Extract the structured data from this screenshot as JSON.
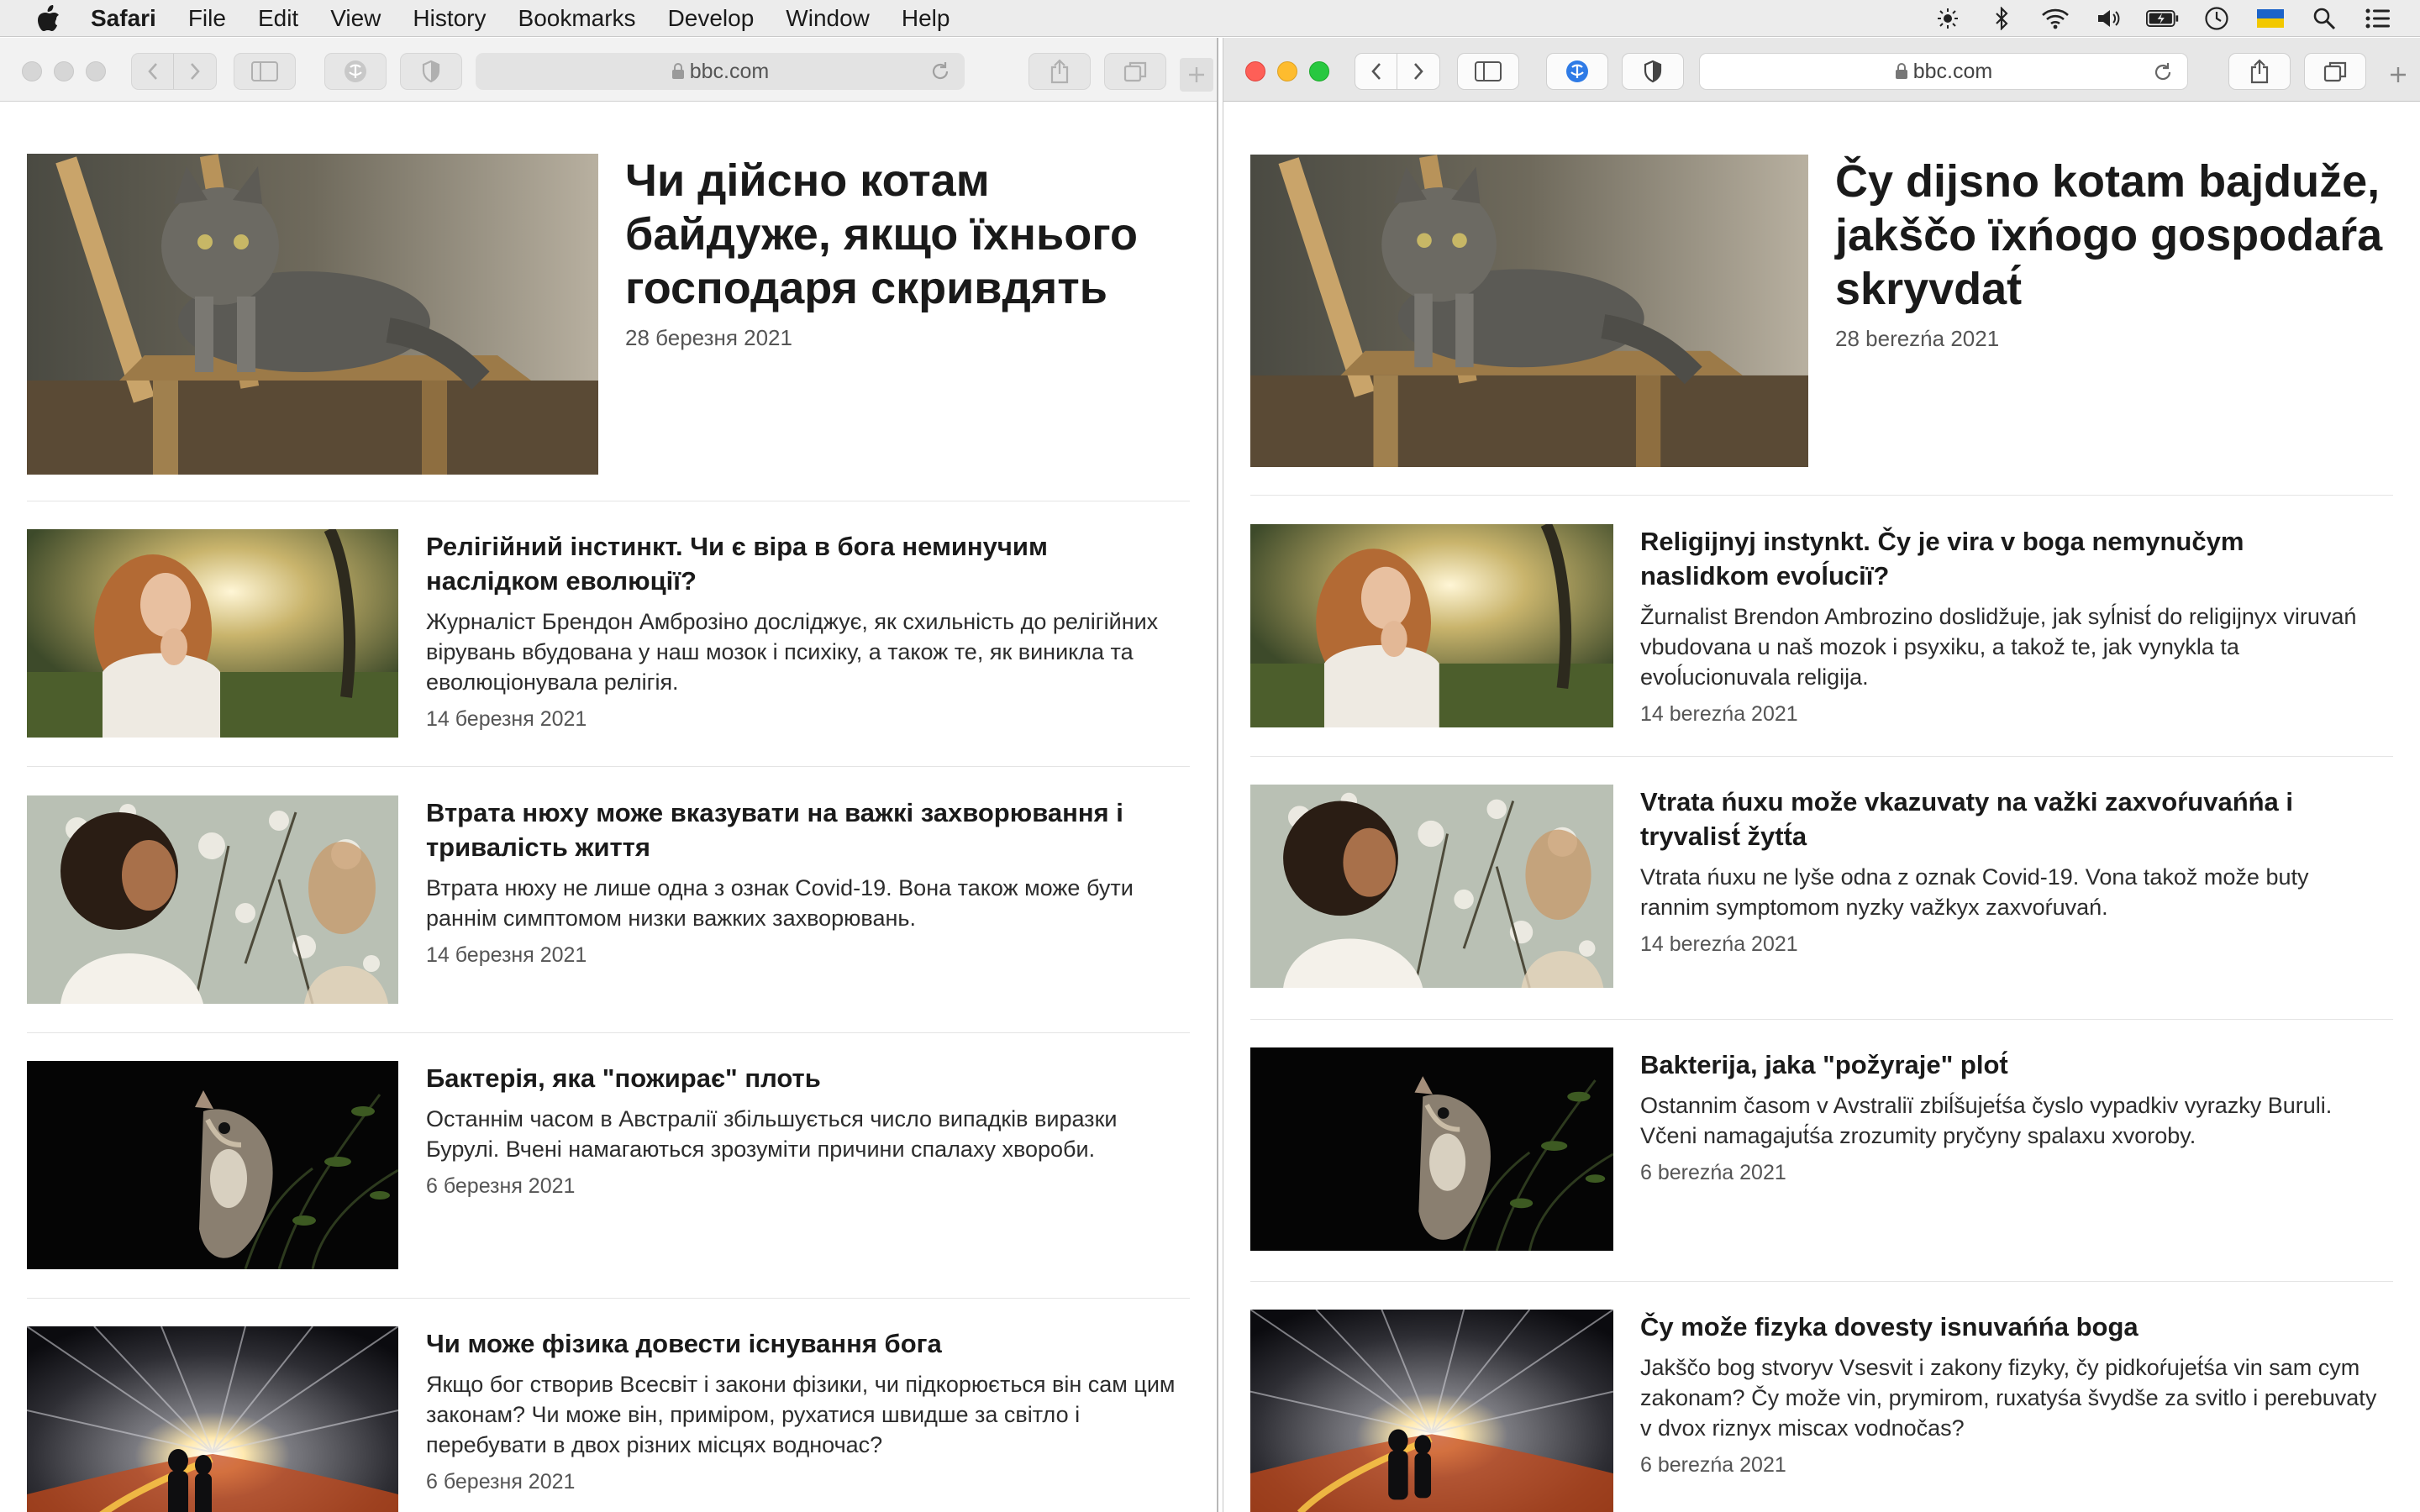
{
  "menubar": {
    "app": "Safari",
    "items": [
      "File",
      "Edit",
      "View",
      "History",
      "Bookmarks",
      "Develop",
      "Window",
      "Help"
    ]
  },
  "left": {
    "address": "bbc.com",
    "lead": {
      "title": "Чи дійсно котам байдуже, якщо їхнього господаря скривдять",
      "date": "28 березня 2021"
    },
    "articles": [
      {
        "title": "Релігійний інстинкт. Чи є віра в бога неминучим наслідком еволюції?",
        "summary": "Журналіст Брендон Амброзіно досліджує, як схильність до релігійних вірувань вбудована у наш мозок і психіку, а також те, як виникла та еволюціонувала релігія.",
        "date": "14 березня 2021"
      },
      {
        "title": "Втрата нюху може вказувати на важкі захворювання і тривалість життя",
        "summary": "Втрата нюху не лише одна з ознак Covid-19. Вона також може бути раннім симптомом низки важких захворювань.",
        "date": "14 березня 2021"
      },
      {
        "title": "Бактерія, яка \"пожирає\" плоть",
        "summary": "Останнім часом в Австралії збільшується число випадків виразки Бурулі. Вчені намагаються зрозуміти причини спалаху хвороби.",
        "date": "6 березня 2021"
      },
      {
        "title": "Чи може фізика довести існування бога",
        "summary": "Якщо бог створив Всесвіт і закони фізики, чи підкорюється він сам цим законам? Чи може він, приміром, рухатися швидше за світло і перебувати в двох різних місцях водночас?",
        "date": "6 березня 2021"
      }
    ]
  },
  "right": {
    "address": "bbc.com",
    "lead": {
      "title": "Čy dijsno kotam bajduže, jakščo ïxńogo gospodaŕa skryvdat́",
      "date": "28 berezńa 2021"
    },
    "articles": [
      {
        "title": "Religijnyj instynkt. Čy je vira v boga nemynučym naslidkom evoĺuciï?",
        "summary": "Žurnalist Brendon Ambrozino doslidžuje, jak syĺnist́ do religijnyx viruvań vbudovana u naš mozok i psyxiku, a takož te, jak vynykla ta evoĺucionuvala religija.",
        "date": "14 berezńa 2021"
      },
      {
        "title": "Vtrata ńuxu može vkazuvaty na važki zaxvoŕuvańńa i tryvalist́ žytt́a",
        "summary": "Vtrata ńuxu ne lyše odna z oznak Covid-19. Vona takož može buty rannim symptomom nyzky važkyx zaxvoŕuvań.",
        "date": "14 berezńa 2021"
      },
      {
        "title": "Bakterija, jaka \"požyraje\" plot́",
        "summary": "Ostannim časom v Avstraliï zbiĺšujet́śa čyslo vypadkiv vyrazky Buruli. Včeni namagajut́śa zrozumity pryčyny spalaxu xvoroby.",
        "date": "6 berezńa 2021"
      },
      {
        "title": "Čy može fizyka dovesty isnuvańńa boga",
        "summary": "Jakščo bog stvoryv Vsesvit i zakony fizyky, čy pidkoŕujet́śa vin sam cym zakonam? Čy može vin, prymirom, ruxatyśa švydše za svitlo i perebuvaty v dvox riznyx miscax vodnočas?",
        "date": "6 berezńa 2021"
      }
    ]
  },
  "colors": {
    "traffic_red": "#fe5f57",
    "traffic_yellow": "#febc2e",
    "traffic_green": "#28c840",
    "accent_blue": "#2f7be6"
  }
}
